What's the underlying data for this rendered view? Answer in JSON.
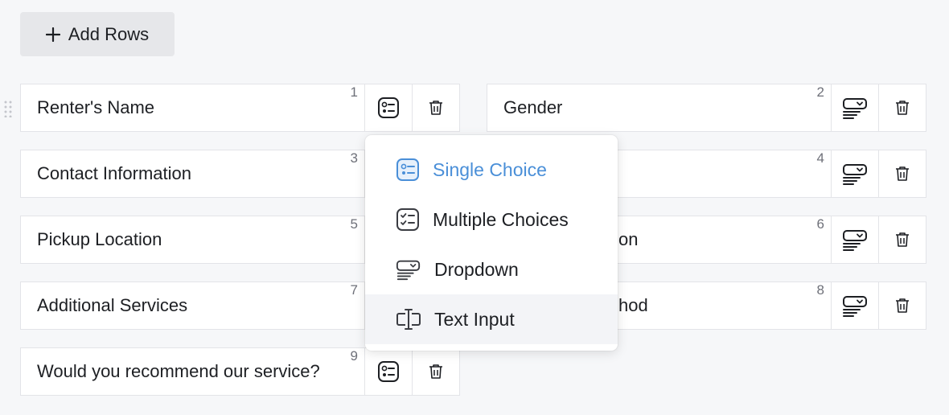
{
  "toolbar": {
    "add_rows_label": "Add Rows",
    "add_icon": "plus-icon"
  },
  "rows": [
    {
      "number": "1",
      "label": "Renter's Name",
      "type_icon": "single-choice-icon"
    },
    {
      "number": "2",
      "label": "Gender",
      "type_icon": "dropdown-icon"
    },
    {
      "number": "3",
      "label": "Contact Information",
      "type_icon": "single-choice-icon"
    },
    {
      "number": "4",
      "label": "",
      "type_icon": "dropdown-icon"
    },
    {
      "number": "5",
      "label": "Pickup Location",
      "type_icon": "single-choice-icon"
    },
    {
      "number": "6",
      "label": "on",
      "type_icon": "dropdown-icon"
    },
    {
      "number": "7",
      "label": "Additional Services",
      "type_icon": "single-choice-icon"
    },
    {
      "number": "8",
      "label": "hod",
      "type_icon": "dropdown-icon"
    },
    {
      "number": "9",
      "label": "Would you recommend our service?",
      "type_icon": "single-choice-icon"
    }
  ],
  "type_menu": {
    "items": [
      {
        "label": "Single Choice",
        "icon": "single-choice-icon",
        "state": "selected"
      },
      {
        "label": "Multiple Choices",
        "icon": "multiple-choice-icon",
        "state": "normal"
      },
      {
        "label": "Dropdown",
        "icon": "dropdown-icon",
        "state": "normal"
      },
      {
        "label": "Text Input",
        "icon": "text-input-icon",
        "state": "hovered"
      }
    ]
  },
  "colors": {
    "accent": "#4a8fd8",
    "row_border": "#e3e4e8",
    "button_bg": "#e6e7ea",
    "page_bg": "#f6f7f9"
  }
}
